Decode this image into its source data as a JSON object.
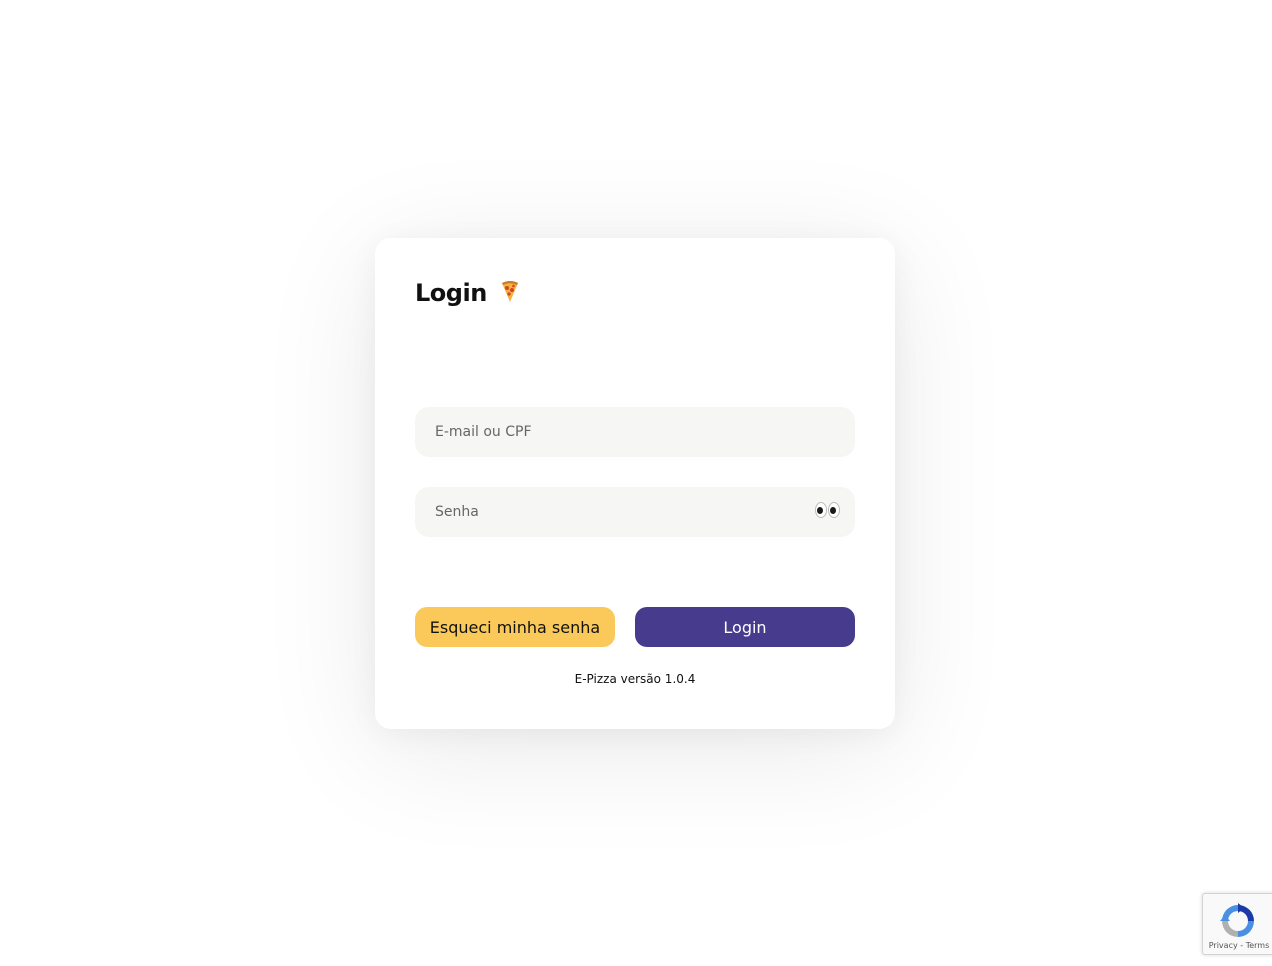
{
  "login_card": {
    "title": "Login",
    "title_icon": "pizza-icon",
    "email_field": {
      "placeholder": "E-mail ou CPF",
      "value": ""
    },
    "password_field": {
      "placeholder": "Senha",
      "value": "",
      "toggle_icon": "eyes-icon"
    },
    "forgot_button_label": "Esqueci minha senha",
    "login_button_label": "Login",
    "version_text": "E-Pizza versão 1.0.4"
  },
  "recaptcha": {
    "privacy_label": "Privacy",
    "separator": " - ",
    "terms_label": "Terms"
  },
  "colors": {
    "primary": "#463b8d",
    "secondary": "#fbc95a",
    "field_background": "#f6f6f4"
  }
}
